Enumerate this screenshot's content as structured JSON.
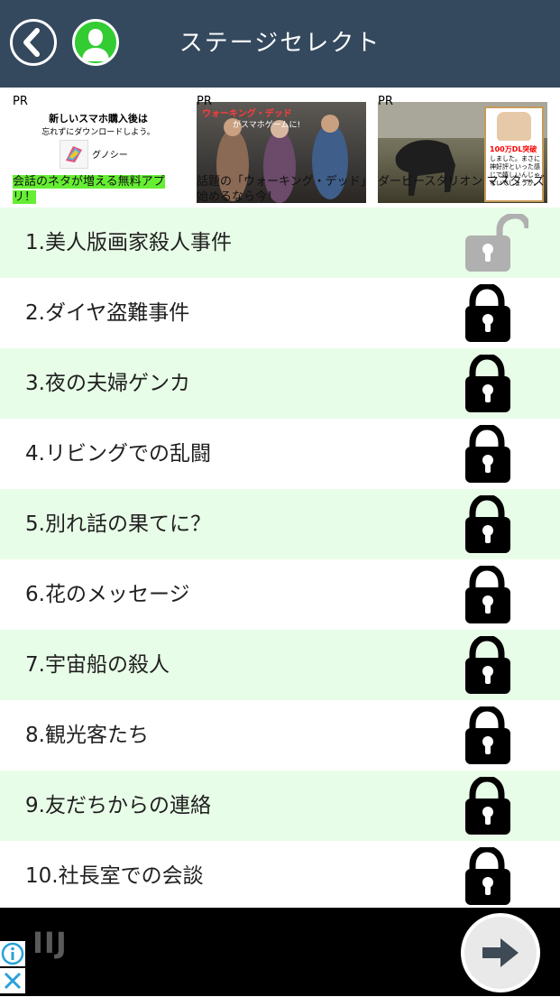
{
  "header": {
    "title": "ステージセレクト"
  },
  "ads": [
    {
      "pr": "PR",
      "line1": "新しいスマホ購入後は",
      "line2": "忘れずにダウンロードしよう。",
      "brand": "グノシー",
      "caption": "会話のネタが増える無料アプリ！"
    },
    {
      "pr": "PR",
      "img_title": "ウォーキング・デッド",
      "img_sub": "がスマホゲームに!",
      "caption": "話題の「ウォーキング・デッド」始めるなら今！"
    },
    {
      "pr": "PR",
      "badge": "100万DL突破",
      "small": "しました。まさに神好評といった感じで嬉しいんじゃないでしょうか。",
      "caption": "ダービースタリオン マスターズ"
    }
  ],
  "stages": [
    {
      "label": "1.美人版画家殺人事件",
      "locked": false
    },
    {
      "label": "2.ダイヤ盗難事件",
      "locked": true
    },
    {
      "label": "3.夜の夫婦ゲンカ",
      "locked": true
    },
    {
      "label": "4.リビングでの乱闘",
      "locked": true
    },
    {
      "label": "5.別れ話の果てに？",
      "locked": true
    },
    {
      "label": "6.花のメッセージ",
      "locked": true
    },
    {
      "label": "7.宇宙船の殺人",
      "locked": true
    },
    {
      "label": "8.観光客たち",
      "locked": true
    },
    {
      "label": "9.友だちからの連絡",
      "locked": true
    },
    {
      "label": "10.社長室での会談",
      "locked": true
    }
  ],
  "bottom_ad": {
    "brand": "IIJ"
  },
  "colors": {
    "header": "#34495e",
    "row_alt": "#e8fde8",
    "user_icon": "#33cc33",
    "lock_locked": "#000000",
    "lock_open": "#b0b0b0"
  }
}
